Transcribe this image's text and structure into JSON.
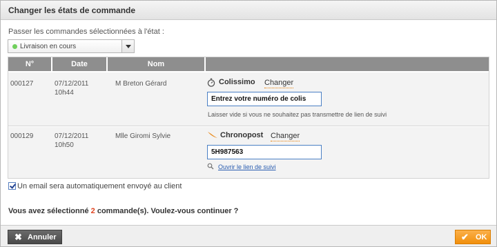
{
  "dialog": {
    "title": "Changer les états de commande"
  },
  "state_prompt": "Passer les commandes sélectionnées à l'état :",
  "state_select": {
    "value": "Livraison en cours",
    "status_color": "#6fcf5b"
  },
  "table": {
    "headers": [
      "N°",
      "Date",
      "Nom",
      ""
    ],
    "rows": [
      {
        "number": "000127",
        "date": "07/12/2011",
        "time": "10h44",
        "name": "M Breton Gérard",
        "carrier": "Colissimo",
        "carrier_icon": "stopwatch-icon",
        "change_label": "Changer",
        "tracking_value": "Entrez votre numéro de colis",
        "hint": "Laisser vide si vous ne souhaitez pas transmettre de lien de suivi"
      },
      {
        "number": "000129",
        "date": "07/12/2011",
        "time": "10h50",
        "name": "Mlle Giromi Sylvie",
        "carrier": "Chronopost",
        "carrier_icon": "swoosh-icon",
        "change_label": "Changer",
        "tracking_value": "5H987563",
        "tracking_link": "Ouvrir le lien de suivi"
      }
    ]
  },
  "email_notice": {
    "checked": true,
    "label": "Un email sera automatiquement envoyé au client"
  },
  "confirmation": {
    "prefix": "Vous avez sélectionné",
    "count": "2",
    "suffix": "commande(s). Voulez-vous continuer ?"
  },
  "footer": {
    "cancel_label": "Annuler",
    "ok_label": "OK"
  },
  "colors": {
    "accent_orange": "#f18f0c",
    "header_gray": "#8e8e8e",
    "count_red": "#e0431f"
  }
}
